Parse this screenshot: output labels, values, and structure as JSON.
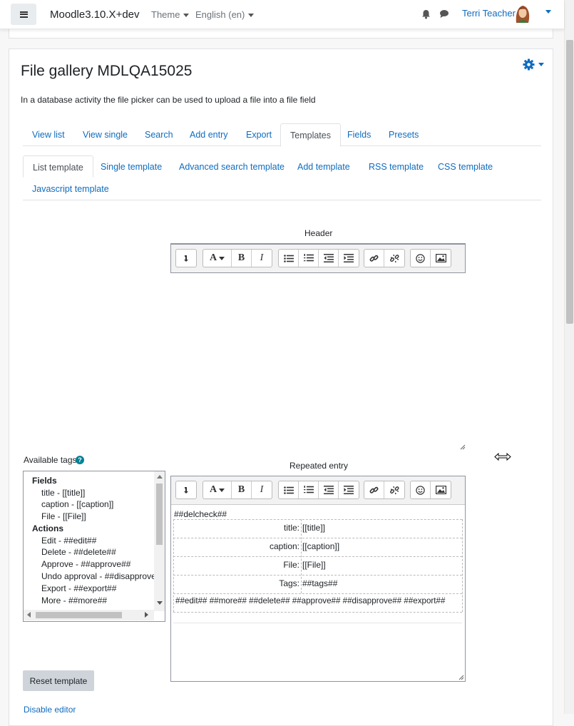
{
  "navbar": {
    "brand": "Moodle3.10.X+dev",
    "theme_label": "Theme",
    "language_label": "English (en)",
    "user_name": "Terri Teacher",
    "icons": [
      "menu-icon",
      "bell-icon",
      "chat-icon",
      "avatar"
    ]
  },
  "page": {
    "title": "File gallery MDLQA15025",
    "intro": "In a database activity the file picker can be used to upload a file into a file field"
  },
  "tabs": [
    {
      "label": "View list",
      "active": false
    },
    {
      "label": "View single",
      "active": false
    },
    {
      "label": "Search",
      "active": false
    },
    {
      "label": "Add entry",
      "active": false
    },
    {
      "label": "Export",
      "active": false
    },
    {
      "label": "Templates",
      "active": true
    },
    {
      "label": "Fields",
      "active": false
    },
    {
      "label": "Presets",
      "active": false
    }
  ],
  "subtabs": [
    {
      "label": "List template",
      "active": true
    },
    {
      "label": "Single template",
      "active": false
    },
    {
      "label": "Advanced search template",
      "active": false
    },
    {
      "label": "Add template",
      "active": false
    },
    {
      "label": "RSS template",
      "active": false
    },
    {
      "label": "CSS template",
      "active": false
    },
    {
      "label": "Javascript template",
      "active": false
    }
  ],
  "header_editor": {
    "label": "Header",
    "content": ""
  },
  "available_tags": {
    "label": "Available tags",
    "groups": [
      {
        "name": "Fields",
        "items": [
          "title - [[title]]",
          "caption - [[caption]]",
          "File - [[File]]"
        ]
      },
      {
        "name": "Actions",
        "items": [
          "Edit - ##edit##",
          "Delete - ##delete##",
          "Approve - ##approve##",
          "Undo approval - ##disapprove##",
          "Export - ##export##",
          "More - ##more##"
        ]
      }
    ]
  },
  "repeated_editor": {
    "label": "Repeated entry",
    "delcheck": "##delcheck##",
    "rows": [
      {
        "label": "title:",
        "value": "[[title]]"
      },
      {
        "label": "caption:",
        "value": "[[caption]]"
      },
      {
        "label": "File:",
        "value": "[[File]]"
      },
      {
        "label": "Tags:",
        "value": "##tags##"
      }
    ],
    "actions_line": "##edit## ##more## ##delete## ##approve## ##disapprove## ##export##"
  },
  "buttons": {
    "reset": "Reset template",
    "disable_editor": "Disable editor"
  },
  "toolbar_icons": [
    "return-icon",
    "font-color-icon",
    "bold-icon",
    "italic-icon",
    "unordered-list-icon",
    "ordered-list-icon",
    "outdent-icon",
    "indent-icon",
    "link-icon",
    "unlink-icon",
    "emoji-icon",
    "image-icon"
  ],
  "colors": {
    "link": "#0f6cbf",
    "help_icon": "#008196",
    "reset_button": "#ced4da"
  }
}
